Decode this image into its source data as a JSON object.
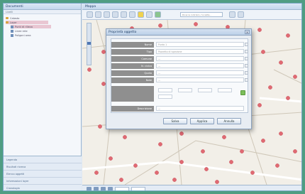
{
  "left_panel": {
    "title": "Documenti",
    "subtitle": "Livelli",
    "tree": [
      {
        "label": "Catasto"
      },
      {
        "label": "Layer"
      },
      {
        "label": "Punti di rilievo"
      },
      {
        "label": "Linee rete"
      },
      {
        "label": "Poligoni area"
      }
    ],
    "bottom_items": [
      {
        "label": "Legenda"
      },
      {
        "label": "Risultati ricerca"
      },
      {
        "label": "Elenco oggetti"
      },
      {
        "label": "Informazioni layer"
      },
      {
        "label": "Cronologia"
      }
    ]
  },
  "map_panel": {
    "title": "Mappa",
    "toolbar_field": "Ricerca indirizzo / località..."
  },
  "dialog": {
    "title": "Proprietà oggetto",
    "close": "×",
    "rows": [
      {
        "label": "Nome",
        "value": "Punto 1"
      },
      {
        "label": "Tipo",
        "value": "Pozzetto di ispezione"
      },
      {
        "label": "Comune",
        "value": "—"
      },
      {
        "label": "N. civico",
        "value": "—"
      },
      {
        "label": "Quota",
        "value": "—"
      },
      {
        "label": "Note",
        "value": "—"
      }
    ],
    "note_label": "Descrizione",
    "note_value": "—",
    "buttons": {
      "ok": "Salva",
      "apply": "Applica",
      "cancel": "Annulla"
    }
  },
  "colors": {
    "map_point": "#e06a73",
    "accent": "#1e3e66"
  }
}
